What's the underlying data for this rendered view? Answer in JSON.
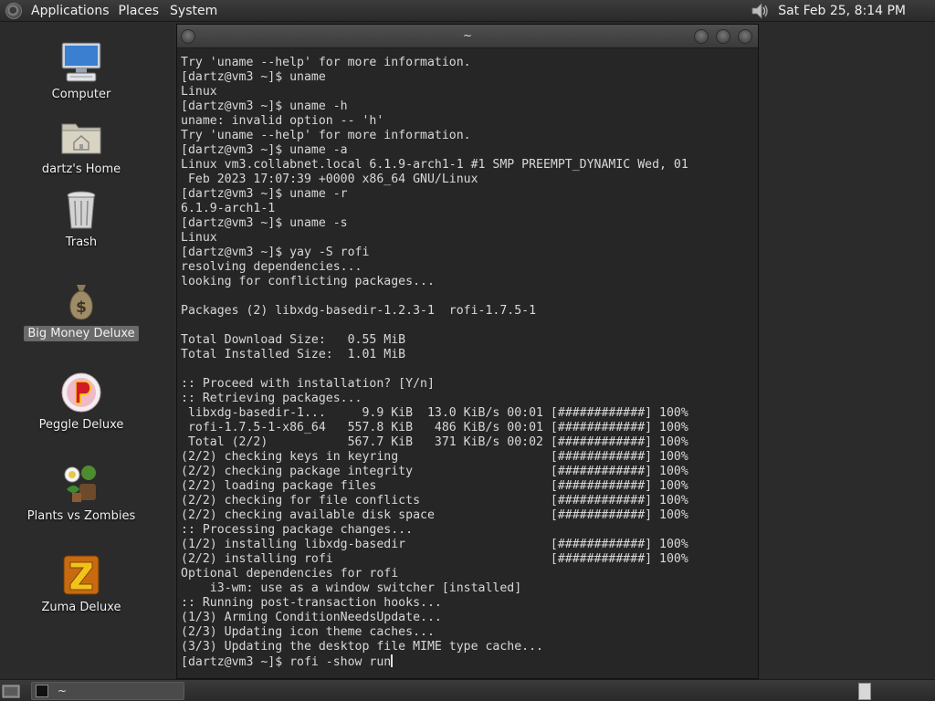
{
  "top_panel": {
    "menus": [
      "Applications",
      "Places",
      "System"
    ],
    "clock": "Sat Feb 25,  8:14 PM"
  },
  "desktop": {
    "icons": [
      {
        "label": "Computer",
        "icon": "computer-icon",
        "selected": false
      },
      {
        "label": "dartz's Home",
        "icon": "home-folder-icon",
        "selected": false
      },
      {
        "label": "Trash",
        "icon": "trash-icon",
        "selected": false
      },
      {
        "label": "Big Money Deluxe",
        "icon": "money-bag-icon",
        "selected": true
      },
      {
        "label": "Peggle Deluxe",
        "icon": "peggle-icon",
        "selected": false
      },
      {
        "label": "Plants vs Zombies",
        "icon": "plants-vs-zombies-icon",
        "selected": false
      },
      {
        "label": "Zuma Deluxe",
        "icon": "zuma-icon",
        "selected": false
      }
    ]
  },
  "terminal": {
    "title": "~",
    "lines": [
      "Try 'uname --help' for more information.",
      "[dartz@vm3 ~]$ uname",
      "Linux",
      "[dartz@vm3 ~]$ uname -h",
      "uname: invalid option -- 'h'",
      "Try 'uname --help' for more information.",
      "[dartz@vm3 ~]$ uname -a",
      "Linux vm3.collabnet.local 6.1.9-arch1-1 #1 SMP PREEMPT_DYNAMIC Wed, 01",
      " Feb 2023 17:07:39 +0000 x86_64 GNU/Linux",
      "[dartz@vm3 ~]$ uname -r",
      "6.1.9-arch1-1",
      "[dartz@vm3 ~]$ uname -s",
      "Linux",
      "[dartz@vm3 ~]$ yay -S rofi",
      "resolving dependencies...",
      "looking for conflicting packages...",
      "",
      "Packages (2) libxdg-basedir-1.2.3-1  rofi-1.7.5-1",
      "",
      "Total Download Size:   0.55 MiB",
      "Total Installed Size:  1.01 MiB",
      "",
      ":: Proceed with installation? [Y/n]",
      ":: Retrieving packages...",
      " libxdg-basedir-1...     9.9 KiB  13.0 KiB/s 00:01 [############] 100%",
      " rofi-1.7.5-1-x86_64   557.8 KiB   486 KiB/s 00:01 [############] 100%",
      " Total (2/2)           567.7 KiB   371 KiB/s 00:02 [############] 100%",
      "(2/2) checking keys in keyring                     [############] 100%",
      "(2/2) checking package integrity                   [############] 100%",
      "(2/2) loading package files                        [############] 100%",
      "(2/2) checking for file conflicts                  [############] 100%",
      "(2/2) checking available disk space                [############] 100%",
      ":: Processing package changes...",
      "(1/2) installing libxdg-basedir                    [############] 100%",
      "(2/2) installing rofi                              [############] 100%",
      "Optional dependencies for rofi",
      "    i3-wm: use as a window switcher [installed]",
      ":: Running post-transaction hooks...",
      "(1/3) Arming ConditionNeedsUpdate...",
      "(2/3) Updating icon theme caches...",
      "(3/3) Updating the desktop file MIME type cache...",
      "[dartz@vm3 ~]$ rofi -show run"
    ]
  },
  "taskbar": {
    "task_label": "~"
  }
}
